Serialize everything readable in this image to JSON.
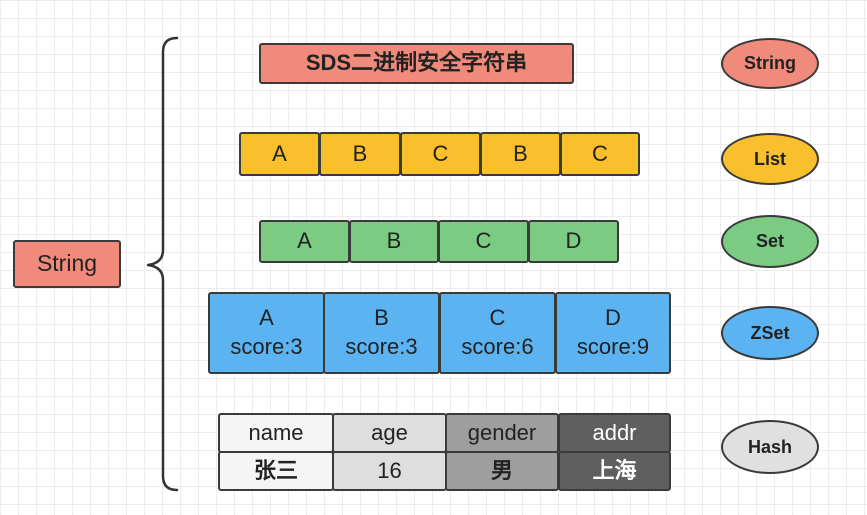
{
  "root": {
    "label": "String"
  },
  "string_row": {
    "content": "SDS二进制安全字符串",
    "type": "String"
  },
  "list_row": {
    "items": [
      "A",
      "B",
      "C",
      "B",
      "C"
    ],
    "type": "List"
  },
  "set_row": {
    "items": [
      "A",
      "B",
      "C",
      "D"
    ],
    "type": "Set"
  },
  "zset_row": {
    "items": [
      {
        "member": "A",
        "score": "score:3"
      },
      {
        "member": "B",
        "score": "score:3"
      },
      {
        "member": "C",
        "score": "score:6"
      },
      {
        "member": "D",
        "score": "score:9"
      }
    ],
    "type": "ZSet"
  },
  "hash_row": {
    "fields": [
      "name",
      "age",
      "gender",
      "addr"
    ],
    "values": [
      "张三",
      "16",
      "男",
      "上海"
    ],
    "type": "Hash"
  },
  "colors": {
    "red": "#f08a7a",
    "yellow": "#f9bf2c",
    "green": "#7ccb82",
    "blue": "#5bb3f2",
    "grey_light": "#f5f5f5",
    "grey_mid": "#dedede",
    "grey_dark": "#9e9e9e",
    "grey_darkest": "#5f5f5f",
    "ellipse_string": "#f08a7a",
    "ellipse_list": "#f9bf2c",
    "ellipse_set": "#7ccb82",
    "ellipse_zset": "#5bb3f2",
    "ellipse_hash": "#e0e0e0"
  }
}
